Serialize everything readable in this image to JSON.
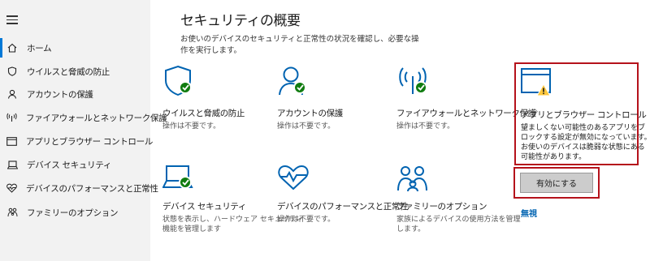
{
  "sidebar": {
    "items": [
      {
        "label": "ホーム",
        "icon": "home-icon"
      },
      {
        "label": "ウイルスと脅威の防止",
        "icon": "shield-icon"
      },
      {
        "label": "アカウントの保護",
        "icon": "person-icon"
      },
      {
        "label": "ファイアウォールとネットワーク保護",
        "icon": "wifi-signal-icon"
      },
      {
        "label": "アプリとブラウザー コントロール",
        "icon": "browser-window-icon"
      },
      {
        "label": "デバイス セキュリティ",
        "icon": "laptop-icon"
      },
      {
        "label": "デバイスのパフォーマンスと正常性",
        "icon": "heart-pulse-icon"
      },
      {
        "label": "ファミリーのオプション",
        "icon": "family-icon"
      }
    ]
  },
  "main": {
    "title": "セキュリティの概要",
    "description": "お使いのデバイスのセキュリティと正常性の状況を確認し、必要な操作を実行します。",
    "tiles": [
      {
        "title": "ウイルスと脅威の防止",
        "status": "操作は不要です。",
        "icon": "shield-icon",
        "badge": "check"
      },
      {
        "title": "アカウントの保護",
        "status": "操作は不要です。",
        "icon": "person-icon",
        "badge": "check"
      },
      {
        "title": "ファイアウォールとネットワーク保護",
        "status": "操作は不要です。",
        "icon": "wifi-signal-icon",
        "badge": "check"
      },
      {
        "title": "アプリとブラウザー コントロール",
        "status_lines": [
          "望ましくない可能性のあるアプリをブ",
          "ロックする設定が無効になっています。",
          "お使いのデバイスは脆弱な状態にある",
          "可能性があります。"
        ],
        "icon": "browser-window-icon",
        "badge": "warning"
      },
      {
        "title": "デバイス セキュリティ",
        "status_lines": [
          "状態を表示し、ハードウェア セキュリティ",
          "機能を管理します"
        ],
        "icon": "laptop-icon",
        "badge": "check"
      },
      {
        "title": "デバイスのパフォーマンスと正常性",
        "status": "操作は不要です。",
        "icon": "heart-pulse-icon",
        "badge": "none"
      },
      {
        "title": "ファミリーのオプション",
        "status_lines": [
          "家族によるデバイスの使用方法を管理",
          "します。"
        ],
        "icon": "family-icon",
        "badge": "none"
      }
    ],
    "enable_button": "有効にする",
    "dismiss_link": "無視"
  },
  "colors": {
    "accent": "#0078d7",
    "ok": "#107c10",
    "warning": "#ffc83d",
    "highlight": "#b5121b",
    "link": "#0063b1",
    "icon_blue": "#0063b1"
  }
}
